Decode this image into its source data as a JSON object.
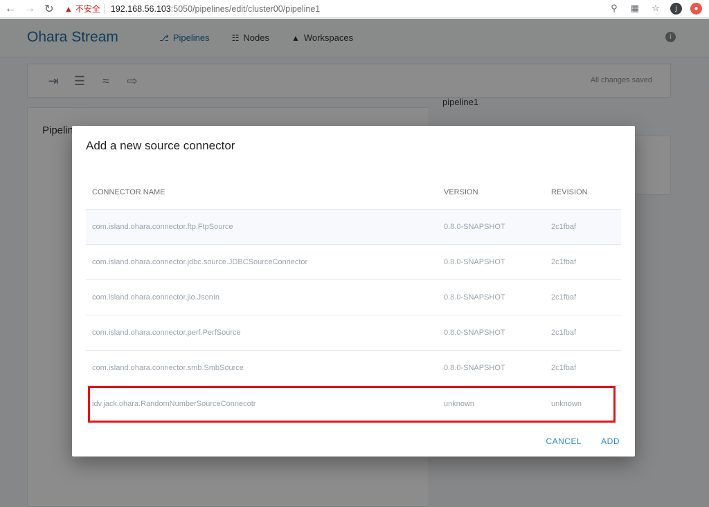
{
  "browser": {
    "warning_text": "不安全",
    "url_host": "192.168.56.103",
    "url_rest": ":5050/pipelines/edit/cluster00/pipeline1",
    "avatar_letter": "j"
  },
  "app": {
    "brand": "Ohara Stream",
    "nav": [
      {
        "label": "Pipelines",
        "icon": "pipelines-icon",
        "active": true
      },
      {
        "label": "Nodes",
        "icon": "nodes-icon",
        "active": false
      },
      {
        "label": "Workspaces",
        "icon": "workspaces-icon",
        "active": false
      }
    ],
    "toolbar": {
      "tools": [
        "add-source-icon",
        "list-icon",
        "stream-icon",
        "export-sink-icon"
      ],
      "status": "All changes saved"
    },
    "left_panel_title": "Pipeline graph",
    "right_panel_title": "pipeline1"
  },
  "modal": {
    "title": "Add a new source connector",
    "columns": [
      "CONNECTOR NAME",
      "VERSION",
      "REVISION"
    ],
    "rows": [
      {
        "name": "com.island.ohara.connector.ftp.FtpSource",
        "version": "0.8.0-SNAPSHOT",
        "revision": "2c1fbaf"
      },
      {
        "name": "com.island.ohara.connector.jdbc.source.JDBCSourceConnector",
        "version": "0.8.0-SNAPSHOT",
        "revision": "2c1fbaf"
      },
      {
        "name": "com.island.ohara.connector.jio.JsonIn",
        "version": "0.8.0-SNAPSHOT",
        "revision": "2c1fbaf"
      },
      {
        "name": "com.island.ohara.connector.perf.PerfSource",
        "version": "0.8.0-SNAPSHOT",
        "revision": "2c1fbaf"
      },
      {
        "name": "com.island.ohara.connector.smb.SmbSource",
        "version": "0.8.0-SNAPSHOT",
        "revision": "2c1fbaf"
      },
      {
        "name": "idv.jack.ohara.RandomNumberSourceConnecotr",
        "version": "unknown",
        "revision": "unknown"
      }
    ],
    "cancel_label": "CANCEL",
    "add_label": "ADD"
  },
  "colors": {
    "brand": "#1f6ea6",
    "action": "#2b8ad6",
    "highlight": "#e3131b",
    "warning": "#c5221f"
  }
}
